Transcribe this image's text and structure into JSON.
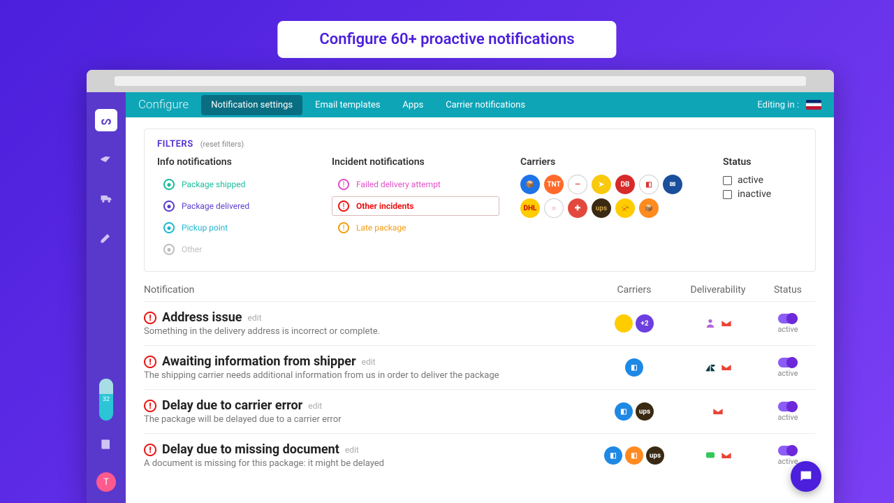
{
  "banner": "Configure 60+ proactive notifications",
  "topbar": {
    "title": "Configure",
    "tabs": [
      "Notification settings",
      "Email templates",
      "Apps",
      "Carrier notifications"
    ],
    "editing": "Editing in :"
  },
  "filters": {
    "title": "FILTERS",
    "reset": "(reset filters)",
    "info": {
      "title": "Info notifications",
      "items": [
        {
          "label": "Package shipped",
          "color": "#1abc9c"
        },
        {
          "label": "Package delivered",
          "color": "#5b3ccf"
        },
        {
          "label": "Pickup point",
          "color": "#1fb6d1"
        },
        {
          "label": "Other",
          "color": "#bdbdbd"
        }
      ]
    },
    "incident": {
      "title": "Incident notifications",
      "items": [
        {
          "label": "Failed delivery attempt",
          "color": "#e04fc7",
          "selected": false
        },
        {
          "label": "Other incidents",
          "color": "#e11",
          "selected": true
        },
        {
          "label": "Late package",
          "color": "#f39c12",
          "selected": false
        }
      ]
    },
    "carriers": {
      "title": "Carriers",
      "dots": [
        {
          "bg": "#1e73e8",
          "txt": "📦"
        },
        {
          "bg": "#ff6a2b",
          "txt": "TNT"
        },
        {
          "bg": "#fff",
          "txt": "—",
          "fg": "#d33"
        },
        {
          "bg": "#f9c90e",
          "txt": "➤"
        },
        {
          "bg": "#d72a2a",
          "txt": "DB"
        },
        {
          "bg": "#fff",
          "txt": "◧",
          "fg": "#d33"
        },
        {
          "bg": "#1b4f9c",
          "txt": "✉"
        },
        {
          "bg": "#ffcc00",
          "txt": "DHL",
          "fg": "#c00"
        },
        {
          "bg": "#fff",
          "txt": "○",
          "fg": "#e55"
        },
        {
          "bg": "#e2483d",
          "txt": "✚"
        },
        {
          "bg": "#3a2a13",
          "txt": "ups",
          "fg": "#c9a24a"
        },
        {
          "bg": "#ffcc00",
          "txt": "📯",
          "fg": "#000"
        },
        {
          "bg": "#ff8a1f",
          "txt": "📦"
        }
      ]
    },
    "status": {
      "title": "Status",
      "options": [
        "active",
        "inactive"
      ]
    }
  },
  "table": {
    "headers": {
      "notification": "Notification",
      "carriers": "Carriers",
      "deliverability": "Deliverability",
      "status": "Status"
    },
    "edit": "edit",
    "status_label": "active",
    "rows": [
      {
        "title": "Address issue",
        "desc": "Something in the delivery address is incorrect or complete.",
        "carriers": [
          {
            "bg": "#ffcc00",
            "txt": ""
          },
          {
            "bg": "#6b3fe0",
            "txt": "+2"
          }
        ],
        "deliv": [
          "person",
          "gmail"
        ]
      },
      {
        "title": "Awaiting information from shipper",
        "desc": "The shipping carrier needs additional information from us in order to deliver the package",
        "carriers": [
          {
            "bg": "#1e88e5",
            "txt": "◧"
          }
        ],
        "deliv": [
          "zendesk",
          "gmail"
        ]
      },
      {
        "title": "Delay due to carrier error",
        "desc": "The package will be delayed due to a carrier error",
        "carriers": [
          {
            "bg": "#1e88e5",
            "txt": "◧"
          },
          {
            "bg": "#3a2a13",
            "txt": "ups"
          }
        ],
        "deliv": [
          "gmail"
        ]
      },
      {
        "title": "Delay due to missing document",
        "desc": "A document is missing for this package: it might be delayed",
        "carriers": [
          {
            "bg": "#1e88e5",
            "txt": "◧"
          },
          {
            "bg": "#ff8a1f",
            "txt": "◧"
          },
          {
            "bg": "#3a2a13",
            "txt": "ups"
          }
        ],
        "deliv": [
          "imsg",
          "gmail"
        ]
      }
    ]
  },
  "sidebar": {
    "avatar": "T",
    "pill": "32"
  }
}
